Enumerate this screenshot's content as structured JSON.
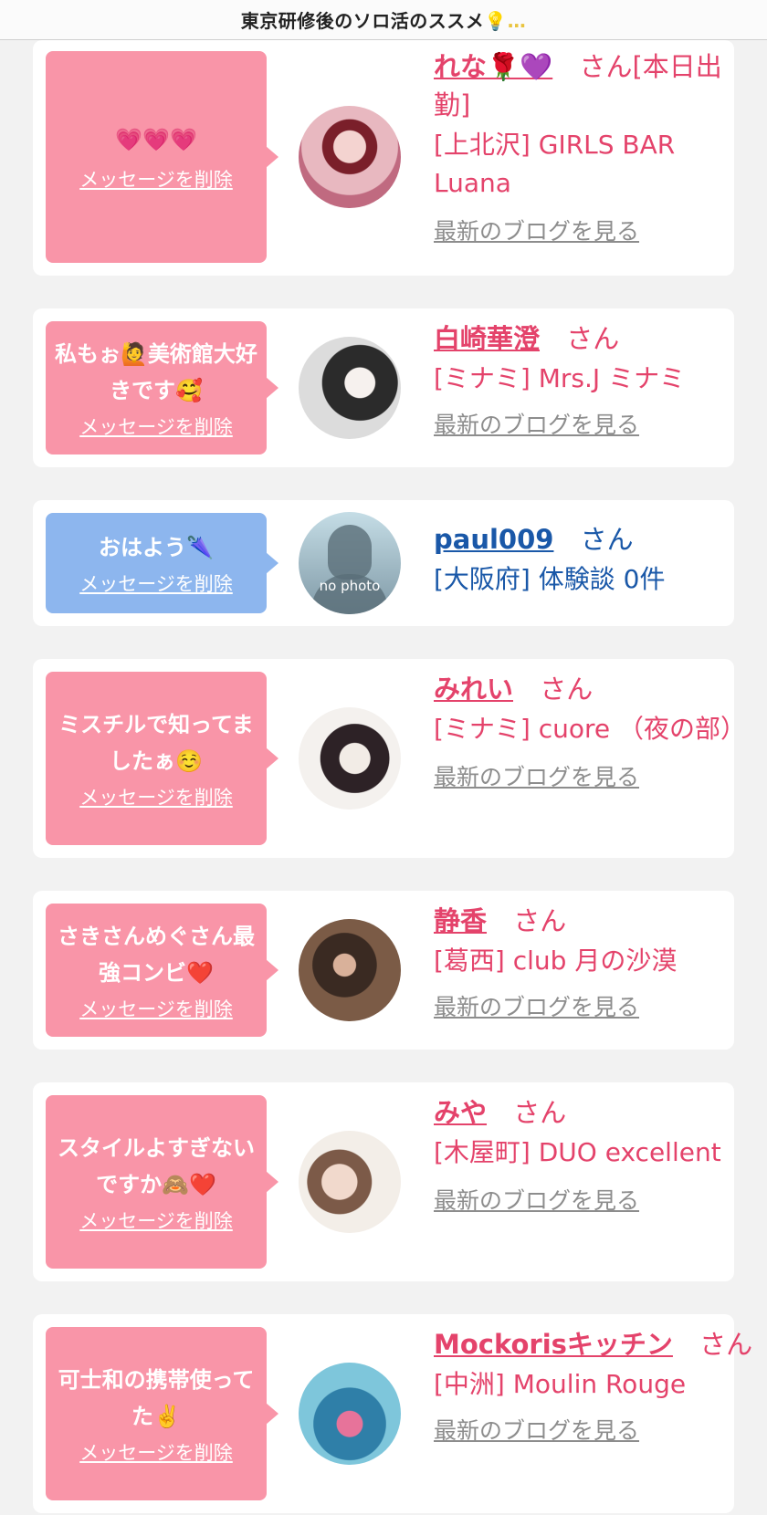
{
  "header": {
    "title": "東京研修後のソロ活のススメ",
    "title_suffix": "💡…"
  },
  "common": {
    "delete_label": "メッセージを削除",
    "blog_label": "最新のブログを見る",
    "san": "さん"
  },
  "messages": [
    {
      "message": "💗💗💗",
      "name": "れな🌹💜",
      "san_suffix": "さん[本日出勤]",
      "shop": "[上北沢] GIRLS BAR Luana",
      "avatar": "profile-photo"
    },
    {
      "message": "私もぉ🙋美術館大好きです🥰",
      "name": "白崎華澄",
      "shop": "[ミナミ] Mrs.J ミナミ",
      "avatar": "profile-photo"
    },
    {
      "message": "おはよう🌂",
      "name": "paul009",
      "shop": "[大阪府] 体験談 0件",
      "avatar_text": "no photo"
    },
    {
      "message": "ミスチルで知ってましたぁ☺️",
      "name": "みれい",
      "shop": "[ミナミ] cuore （夜の部）",
      "avatar": "profile-photo"
    },
    {
      "message": "さきさんめぐさん最強コンビ❤️",
      "name": "静香",
      "shop": "[葛西] club 月の沙漠",
      "avatar": "profile-photo"
    },
    {
      "message": "スタイルよすぎないですか🙈❤️",
      "name": "みや",
      "shop": "[木屋町] DUO excellent",
      "avatar": "profile-photo"
    },
    {
      "message": "可士和の携帯使ってた✌️",
      "name": "Mockorisキッチン",
      "shop": "[中洲] Moulin Rouge",
      "avatar": "profile-photo"
    }
  ],
  "colors": {
    "pink_bubble": "#f995a8",
    "blue_bubble": "#8db6ee",
    "pink_text": "#e4436b",
    "blue_text": "#1a58a8"
  }
}
